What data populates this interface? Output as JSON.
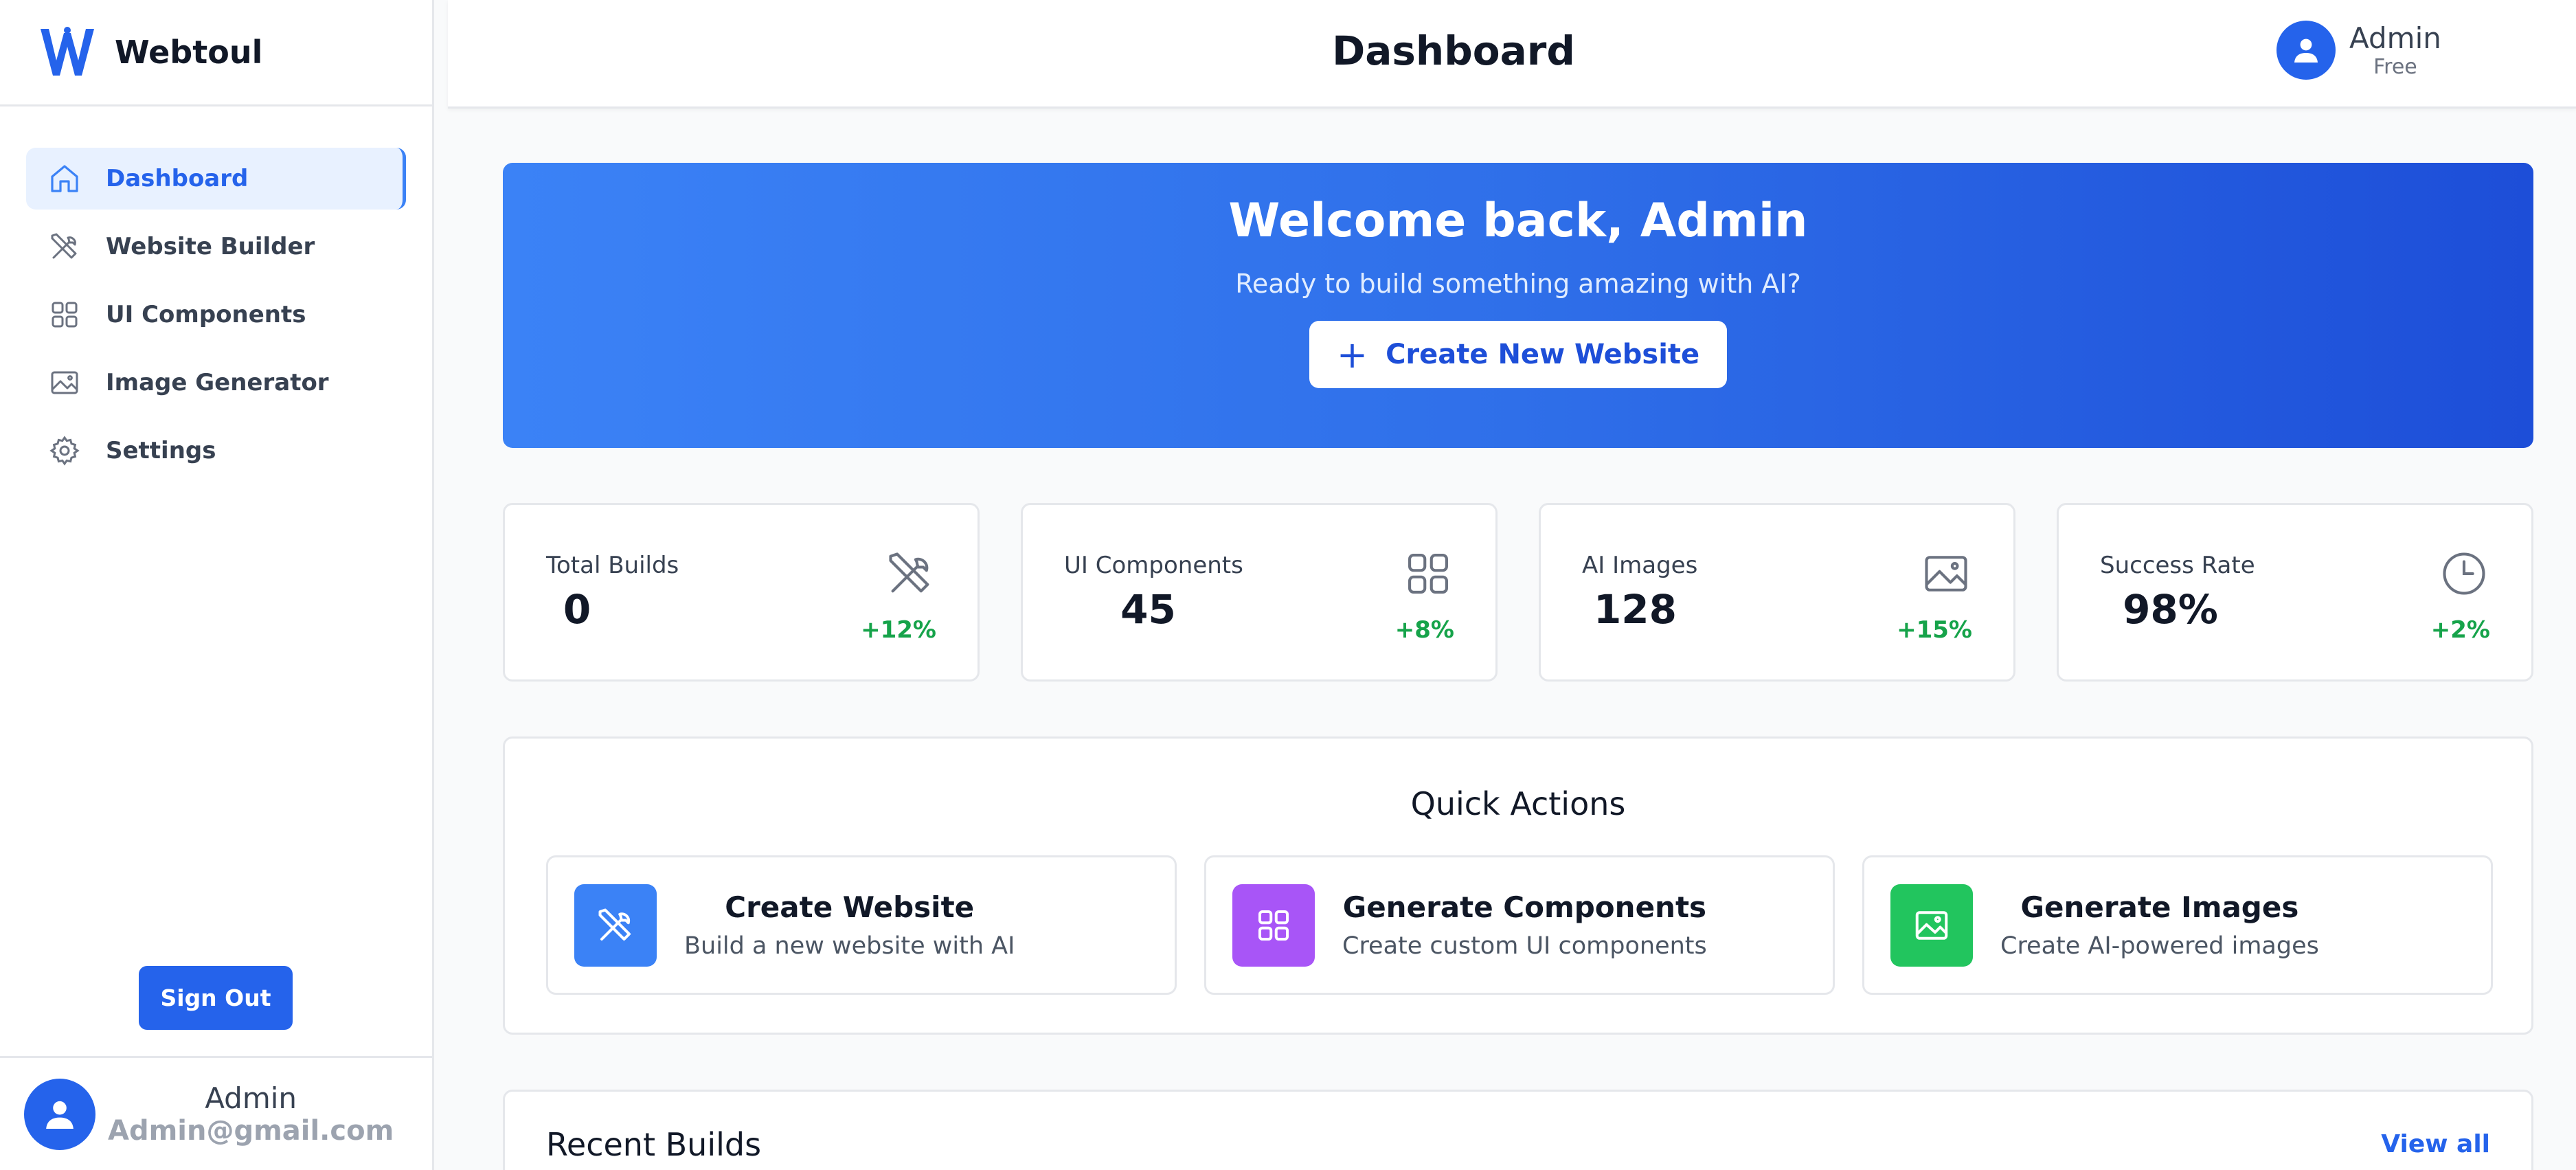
{
  "brand": {
    "name": "Webtoul",
    "logo_color": "#2563eb"
  },
  "sidebar": {
    "items": [
      {
        "label": "Dashboard",
        "icon": "home-icon",
        "active": true
      },
      {
        "label": "Website Builder",
        "icon": "tools-icon",
        "active": false
      },
      {
        "label": "UI Components",
        "icon": "grid-icon",
        "active": false
      },
      {
        "label": "Image Generator",
        "icon": "image-icon",
        "active": false
      },
      {
        "label": "Settings",
        "icon": "gear-icon",
        "active": false
      }
    ],
    "signout_label": "Sign Out",
    "user": {
      "name": "Admin",
      "email": "Admin@gmail.com"
    }
  },
  "header": {
    "title": "Dashboard",
    "user": {
      "name": "Admin",
      "plan": "Free"
    }
  },
  "hero": {
    "title": "Welcome back, Admin",
    "subtitle": "Ready to build something amazing with AI?",
    "button_label": "Create New Website",
    "button_icon": "plus-icon"
  },
  "stats": [
    {
      "label": "Total Builds",
      "value": "0",
      "change": "+12%",
      "icon": "tools-icon"
    },
    {
      "label": "UI Components",
      "value": "45",
      "change": "+8%",
      "icon": "grid-icon"
    },
    {
      "label": "AI Images",
      "value": "128",
      "change": "+15%",
      "icon": "image-icon"
    },
    {
      "label": "Success Rate",
      "value": "98%",
      "change": "+2%",
      "icon": "clock-icon"
    }
  ],
  "quick_actions": {
    "title": "Quick Actions",
    "items": [
      {
        "title": "Create Website",
        "description": "Build a new website with AI",
        "icon": "tools-icon",
        "color": "#3b82f6"
      },
      {
        "title": "Generate Components",
        "description": "Create custom UI components",
        "icon": "grid-icon",
        "color": "#a855f7"
      },
      {
        "title": "Generate Images",
        "description": "Create AI-powered images",
        "icon": "image-icon",
        "color": "#22c55e"
      }
    ]
  },
  "recent_builds": {
    "title": "Recent Builds",
    "view_all_label": "View all"
  },
  "colors": {
    "accent": "#2563eb",
    "positive": "#16a34a"
  }
}
